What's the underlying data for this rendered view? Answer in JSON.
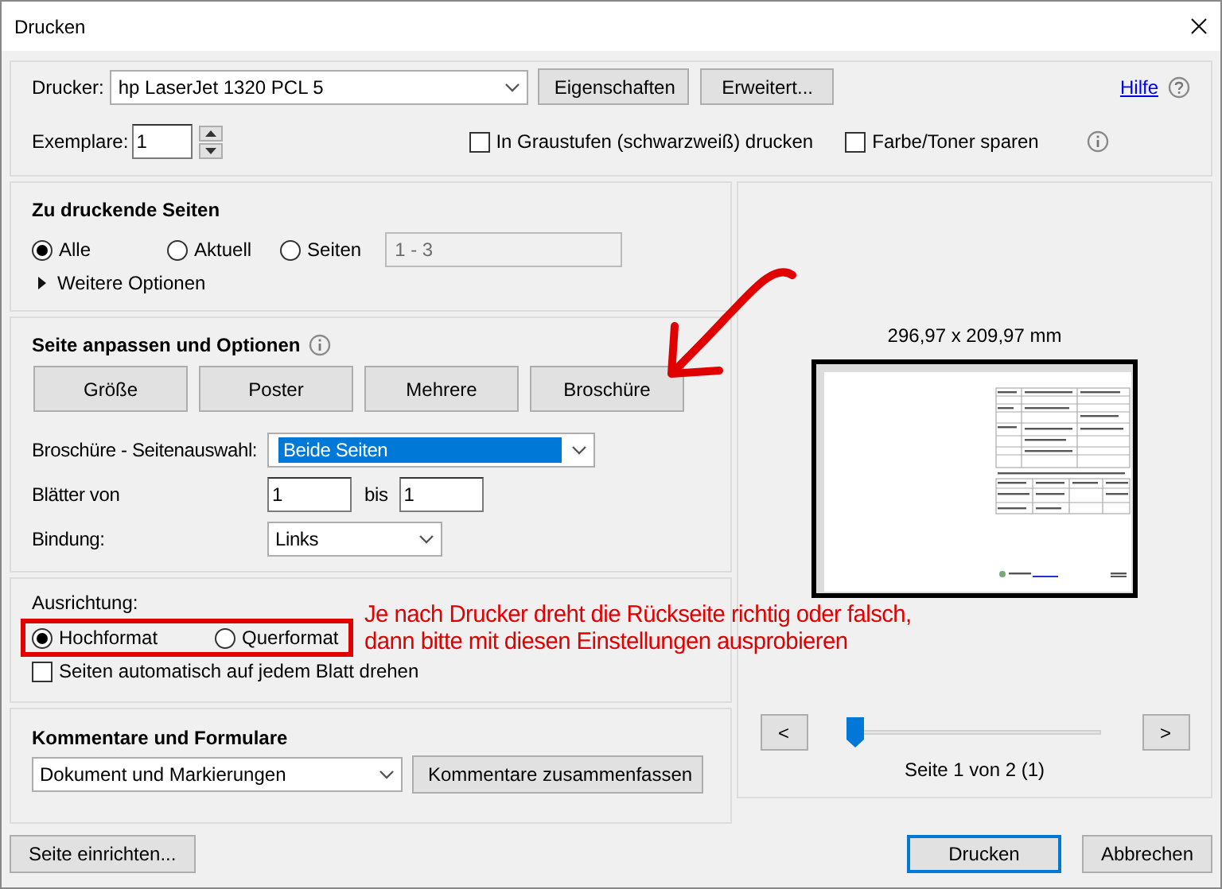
{
  "window": {
    "title": "Drucken"
  },
  "printer": {
    "label": "Drucker:",
    "value": "hp LaserJet 1320 PCL 5",
    "buttons": [
      "Eigenschaften",
      "Erweitert..."
    ],
    "help_link": "Hilfe"
  },
  "copies": {
    "label": "Exemplare:",
    "value": "1"
  },
  "options": [
    {
      "label": "In Graustufen (schwarzweiß) drucken",
      "checked": false
    },
    {
      "label": "Farbe/Toner sparen",
      "checked": false
    }
  ],
  "pages_to_print": {
    "title": "Zu druckende Seiten",
    "choices": [
      {
        "label": "Alle",
        "selected": true
      },
      {
        "label": "Aktuell",
        "selected": false
      },
      {
        "label": "Seiten",
        "selected": false
      }
    ],
    "range": {
      "value": "1 - 3",
      "disabled": true
    },
    "more": {
      "label": "Weitere Optionen",
      "expanded": false
    }
  },
  "fit": {
    "title": "Seite anpassen und Optionen",
    "modes": [
      "Größe",
      "Poster",
      "Mehrere",
      "Broschüre"
    ]
  },
  "booklet": {
    "subset_label": "Broschüre - Seitenauswahl:",
    "subset": "Beide Seiten",
    "sheets_label": "Blätter von",
    "from": "1",
    "to_label": "bis",
    "to": "1",
    "binding_label": "Bindung:",
    "binding": "Links"
  },
  "orientation": {
    "label": "Ausrichtung:",
    "choices": [
      {
        "label": "Hochformat",
        "selected": true
      },
      {
        "label": "Querformat",
        "selected": false
      }
    ],
    "auto_rotate": {
      "label": "Seiten automatisch auf jedem Blatt drehen",
      "checked": false
    }
  },
  "comments": {
    "title": "Kommentare und Formulare",
    "value": "Dokument und Markierungen",
    "button": "Kommentare zusammenfassen"
  },
  "preview": {
    "size": "296,97 x 209,97 mm",
    "prev": "<",
    "next": ">",
    "slider": {
      "level": 0
    },
    "page_info": "Seite 1 von 2 (1)"
  },
  "footer": {
    "setup": "Seite einrichten...",
    "buttons": [
      {
        "label": "Drucken",
        "default": true
      },
      {
        "label": "Abbrechen",
        "default": false
      }
    ]
  },
  "annotation": {
    "text": "Je nach Drucker dreht die Rückseite richtig oder falsch,\ndann bitte mit diesen Einstellungen ausprobieren"
  }
}
